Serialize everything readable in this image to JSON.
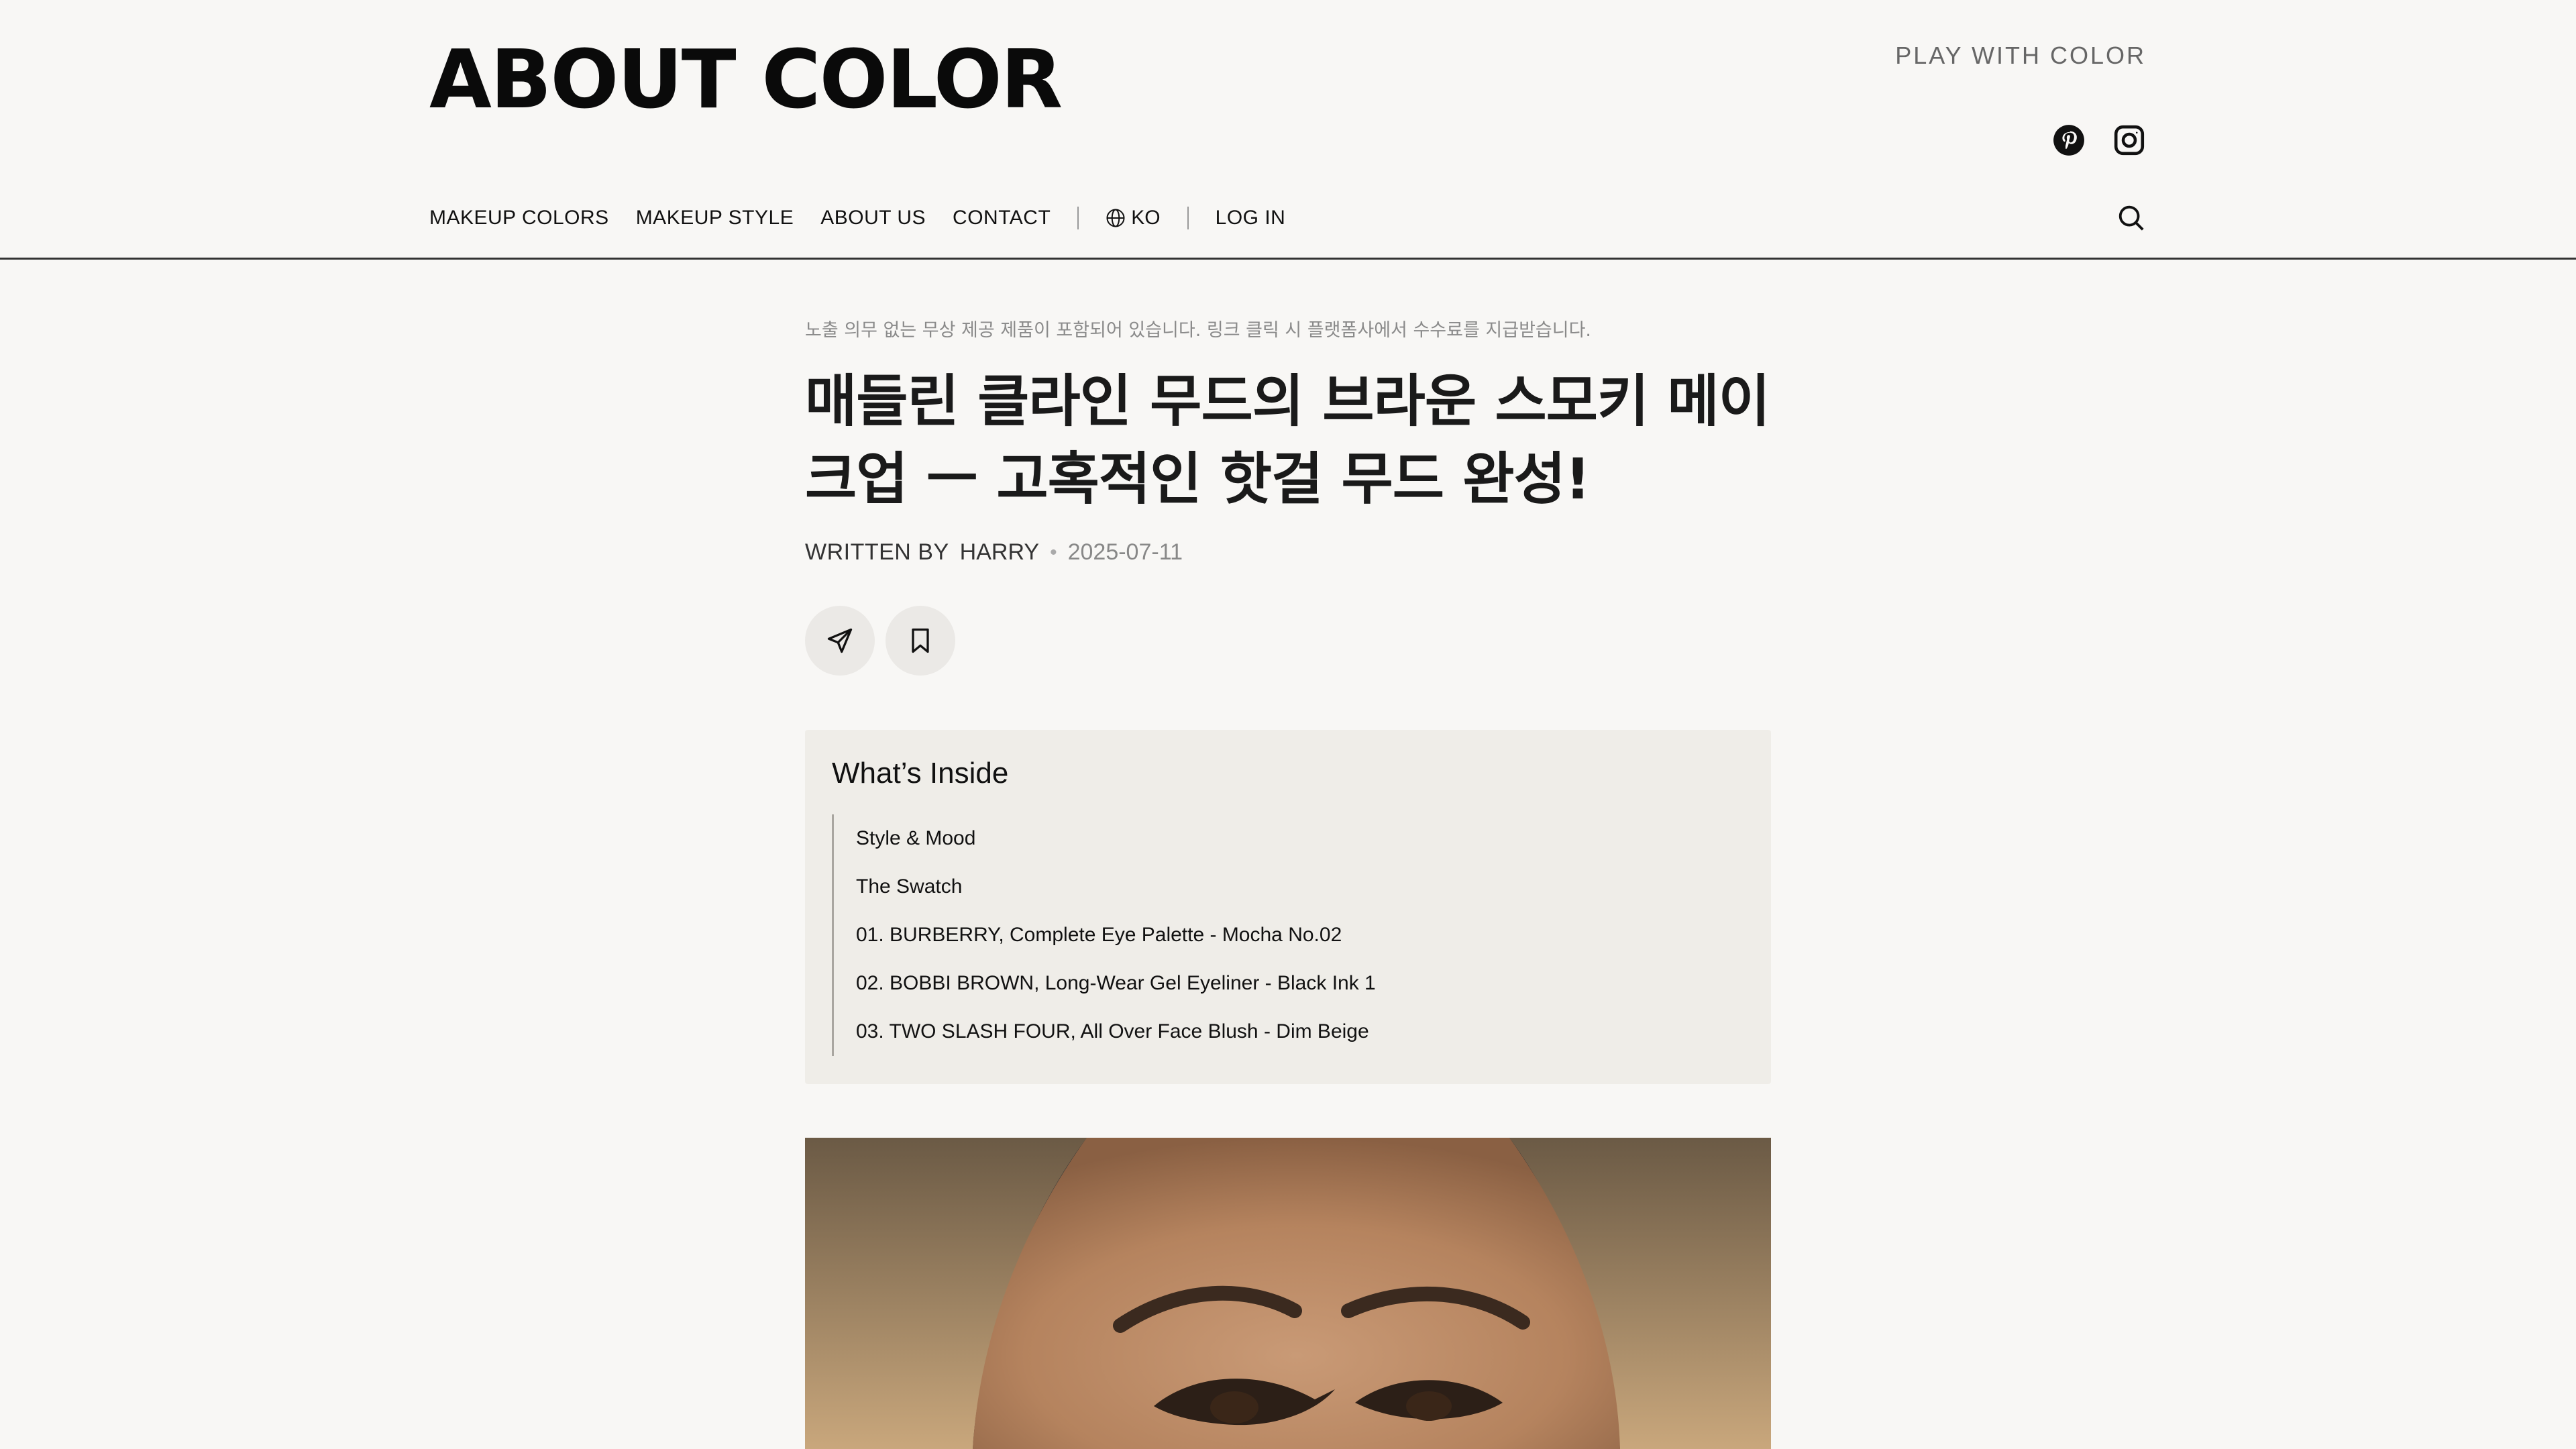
{
  "site": {
    "logo": "ABOUT COLOR",
    "tagline": "PLAY WITH COLOR",
    "social_icons": [
      "pinterest-icon",
      "instagram-icon"
    ]
  },
  "nav": {
    "items": [
      "MAKEUP COLORS",
      "MAKEUP STYLE",
      "ABOUT US",
      "CONTACT"
    ],
    "language": "KO",
    "login": "LOG IN",
    "search_icon": "search-icon"
  },
  "article": {
    "disclaimer": "노출 의무 없는 무상 제공 제품이 포함되어 있습니다. 링크 클릭 시 플랫폼사에서 수수료를 지급받습니다.",
    "title": "매들린 클라인 무드의 브라운 스모키 메이크업 ㅡ 고혹적인 핫걸 무드 완성!",
    "written_by": "WRITTEN BY",
    "author": "HARRY",
    "separator": "•",
    "date": "2025-07-11",
    "actions": [
      "share-icon",
      "bookmark-icon"
    ]
  },
  "toc": {
    "title": "What’s Inside",
    "items": [
      "Style & Mood",
      "The Swatch",
      "01. BURBERRY, Complete Eye Palette - Mocha No.02",
      "02. BOBBI BROWN, Long-Wear Gel Eyeliner - Black Ink 1",
      "03. TWO SLASH FOUR, All Over Face Blush - Dim Beige"
    ]
  },
  "colors": {
    "background": "#f8f7f5",
    "toc_background": "#efede8",
    "text": "#111111",
    "muted": "#8a8a8a"
  }
}
